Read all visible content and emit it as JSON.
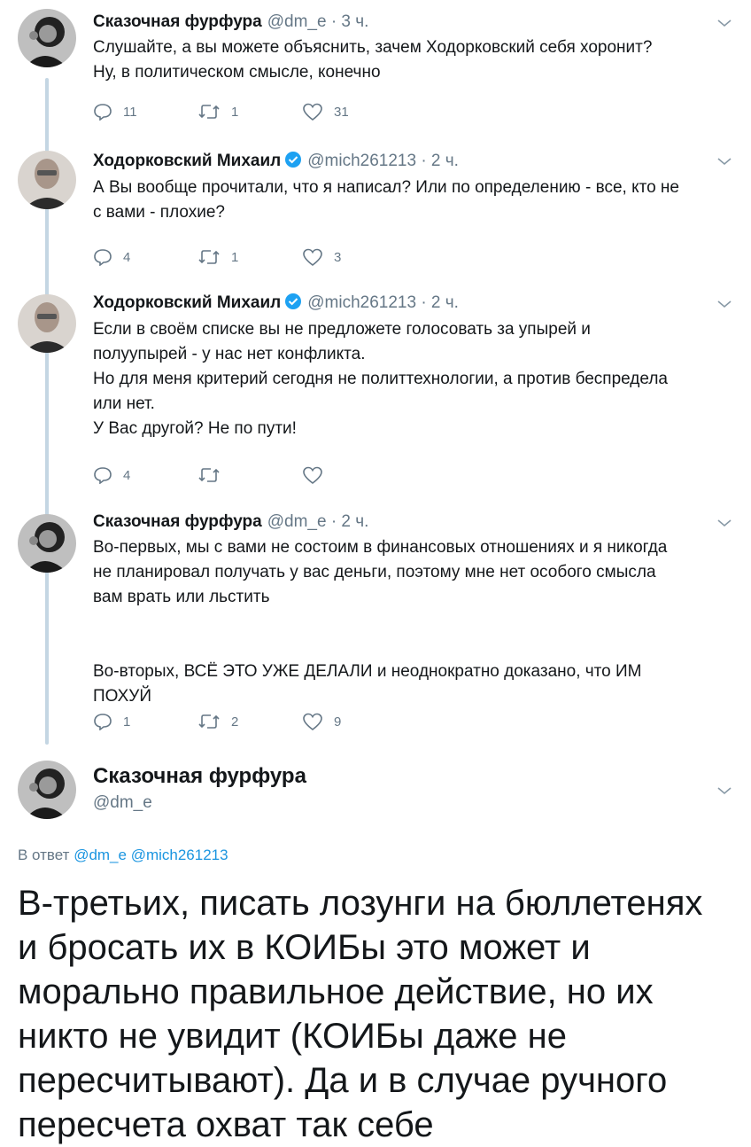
{
  "tweets": [
    {
      "name": "Сказочная фурфура",
      "handle": "@dm_e · 3 ч.",
      "verified": false,
      "lines": [
        "Слушайте, а вы можете объяснить, зачем Ходорковский себя хоронит?",
        "Ну, в политическом смысле, конечно"
      ],
      "replies": "11",
      "retweets": "1",
      "likes": "31"
    },
    {
      "name": "Ходорковский Михаил",
      "handle": "@mich261213 · 2 ч.",
      "verified": true,
      "lines": [
        "А Вы вообще прочитали, что я написал? Или по определению - все, кто не",
        "с вами - плохие?"
      ],
      "replies": "4",
      "retweets": "1",
      "likes": "3"
    },
    {
      "name": "Ходорковский Михаил",
      "handle": "@mich261213 · 2 ч.",
      "verified": true,
      "lines": [
        "Если в своём списке вы не предложете голосовать за упырей и",
        "полуупырей  - у нас нет конфликта.",
        "Но для меня критерий сегодня не политтехнологии, а против беспредела",
        "или нет.",
        "У Вас другой? Не по пути!"
      ],
      "replies": "4",
      "retweets": "",
      "likes": ""
    },
    {
      "name": "Сказочная фурфура",
      "handle": "@dm_e · 2 ч.",
      "verified": false,
      "lines": [
        "Во-первых, мы с вами не состоим в финансовых отношениях и я никогда",
        "не планировал получать у вас деньги, поэтому мне нет особого смысла",
        "вам врать или льстить",
        "",
        "Во-вторых, ВСЁ ЭТО УЖЕ ДЕЛАЛИ и неоднократно доказано, что ИМ",
        "ПОХУЙ"
      ],
      "replies": "1",
      "retweets": "2",
      "likes": "9"
    }
  ],
  "main_tweet": {
    "name": "Сказочная фурфура",
    "handle": "@dm_e",
    "reply_prefix": "В ответ",
    "reply_mentions": "@dm_e @mich261213",
    "lines": [
      "В-третьих, писать лозунги на бюллетенях",
      "и бросать их в КОИБы это может и",
      "морально правильное действие, но их",
      "никто не увидит (КОИБы даже не",
      "пересчитывают). Да и в случае ручного",
      "пересчета охват так себе"
    ]
  },
  "colors": {
    "thread_line": "#c4d6e3",
    "secondary_text": "#657786",
    "link": "#1b95e0",
    "verified": "#1da1f2"
  }
}
